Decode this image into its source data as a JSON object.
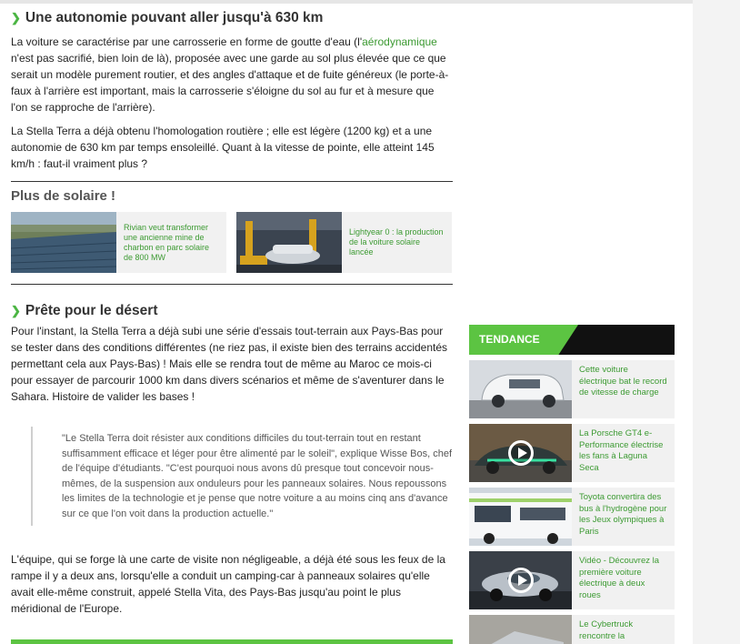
{
  "section1": {
    "title": "Une autonomie pouvant aller jusqu'à 630 km",
    "p1_before": "La voiture se caractérise par une carrosserie en forme de goutte d'eau (l'",
    "p1_link": "aérodynamique",
    "p1_after": " n'est pas sacrifié, bien loin de là), proposée avec une garde au sol plus élevée que ce que serait un modèle purement routier, et des angles d'attaque et de fuite généreux (le porte-à-faux à l'arrière est important, mais la carrosserie s'éloigne du sol au fur et à mesure que l'on se rapproche de l'arrière).",
    "p2": "La Stella Terra a déjà obtenu l'homologation routière ; elle est légère (1200 kg) et a une autonomie de 630 km par temps ensoleillé. Quant à la vitesse de pointe, elle atteint 145 km/h : faut-il vraiment plus ?"
  },
  "related": {
    "title": "Plus de solaire !",
    "cards": [
      {
        "text": "Rivian veut transformer une ancienne mine de charbon en parc solaire de 800 MW"
      },
      {
        "text": "Lightyear 0 : la production de la voiture solaire lancée"
      }
    ]
  },
  "section2": {
    "title": "Prête pour le désert",
    "p1": "Pour l'instant, la Stella Terra a déjà subi une série d'essais tout-terrain aux Pays-Bas pour se tester dans des conditions différentes (ne riez pas, il existe bien des terrains accidentés permettant cela aux Pays-Bas) ! Mais elle se rendra tout de même au Maroc ce mois-ci pour essayer de parcourir 1000 km dans divers scénarios et même de s'aventurer dans le Sahara. Histoire de valider les bases !",
    "quote": "\"Le Stella Terra doit résister aux conditions difficiles du tout-terrain tout en restant suffisamment efficace et léger pour être alimenté par le soleil\", explique Wisse Bos, chef de l'équipe d'étudiants. \"C'est pourquoi nous avons dû presque tout concevoir nous-mêmes, de la suspension aux onduleurs pour les panneaux solaires. Nous repoussons les limites de la technologie et je pense que notre voiture a au moins cinq ans d'avance sur ce que l'on voit dans la production actuelle.\"",
    "p2": "L'équipe, qui se forge là une carte de visite non négligeable, a déjà été sous les feux de la rampe il y a deux ans, lorsqu'elle a conduit un camping-car à panneaux solaires qu'elle avait elle-même construit, appelé Stella Vita, des Pays-Bas jusqu'au point le plus méridional de l'Europe."
  },
  "sidebar": {
    "heading": "TENDANCE",
    "items": [
      {
        "text": "Cette voiture électrique bat le record de vitesse de charge"
      },
      {
        "text": "La Porsche GT4 e-Performance électrise les fans à Laguna Seca"
      },
      {
        "text": "Toyota convertira des bus à l'hydrogène pour les Jeux olympiques à Paris"
      },
      {
        "text": "Vidéo - Découvrez la première voiture électrique à deux roues"
      },
      {
        "text": "Le Cybertruck rencontre la"
      }
    ]
  },
  "colors": {
    "accent": "#5cc442",
    "link": "#3c9a32"
  }
}
